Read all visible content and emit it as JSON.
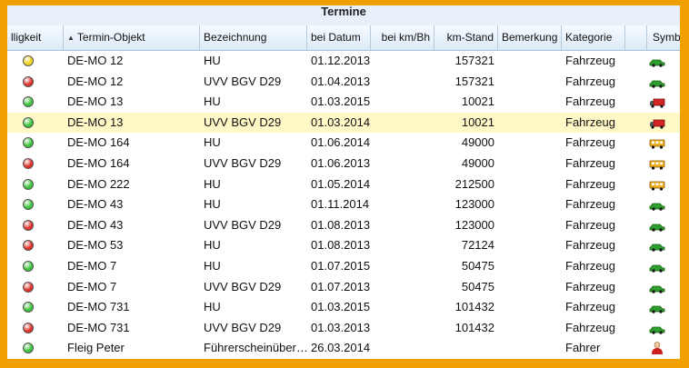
{
  "window": {
    "title": "Termine"
  },
  "columns": [
    {
      "key": "status",
      "label": "lligkeit"
    },
    {
      "key": "object",
      "label": "Termin-Objekt"
    },
    {
      "key": "desc",
      "label": "Bezeichnung"
    },
    {
      "key": "date",
      "label": "bei Datum"
    },
    {
      "key": "kmbh",
      "label": "bei km/Bh"
    },
    {
      "key": "km",
      "label": "km-Stand"
    },
    {
      "key": "note",
      "label": "Bemerkung"
    },
    {
      "key": "cat",
      "label": "Kategorie"
    },
    {
      "key": "blank",
      "label": ""
    },
    {
      "key": "symbol",
      "label": "Symbo"
    }
  ],
  "status_colors": {
    "yellow": "#f2d21c",
    "red": "#e0312a",
    "green": "#3cc33a"
  },
  "rows": [
    {
      "status": "yellow",
      "object": "DE-MO 12",
      "desc": "HU",
      "date": "01.12.2013",
      "kmbh": "",
      "km": "157321",
      "note": "",
      "cat": "Fahrzeug",
      "icon": "car-icon"
    },
    {
      "status": "red",
      "object": "DE-MO 12",
      "desc": "UVV BGV D29",
      "date": "01.04.2013",
      "kmbh": "",
      "km": "157321",
      "note": "",
      "cat": "Fahrzeug",
      "icon": "car-icon"
    },
    {
      "status": "green",
      "object": "DE-MO 13",
      "desc": "HU",
      "date": "01.03.2015",
      "kmbh": "",
      "km": "10021",
      "note": "",
      "cat": "Fahrzeug",
      "icon": "truck-icon"
    },
    {
      "status": "green",
      "object": "DE-MO 13",
      "desc": "UVV BGV D29",
      "date": "01.03.2014",
      "kmbh": "",
      "km": "10021",
      "note": "",
      "cat": "Fahrzeug",
      "icon": "truck-icon",
      "selected": true
    },
    {
      "status": "green",
      "object": "DE-MO 164",
      "desc": "HU",
      "date": "01.06.2014",
      "kmbh": "",
      "km": "49000",
      "note": "",
      "cat": "Fahrzeug",
      "icon": "bus-icon"
    },
    {
      "status": "red",
      "object": "DE-MO 164",
      "desc": "UVV BGV D29",
      "date": "01.06.2013",
      "kmbh": "",
      "km": "49000",
      "note": "",
      "cat": "Fahrzeug",
      "icon": "bus-icon"
    },
    {
      "status": "green",
      "object": "DE-MO 222",
      "desc": "HU",
      "date": "01.05.2014",
      "kmbh": "",
      "km": "212500",
      "note": "",
      "cat": "Fahrzeug",
      "icon": "bus-icon"
    },
    {
      "status": "green",
      "object": "DE-MO 43",
      "desc": "HU",
      "date": "01.11.2014",
      "kmbh": "",
      "km": "123000",
      "note": "",
      "cat": "Fahrzeug",
      "icon": "car-icon"
    },
    {
      "status": "red",
      "object": "DE-MO 43",
      "desc": "UVV BGV D29",
      "date": "01.08.2013",
      "kmbh": "",
      "km": "123000",
      "note": "",
      "cat": "Fahrzeug",
      "icon": "car-icon"
    },
    {
      "status": "red",
      "object": "DE-MO 53",
      "desc": "HU",
      "date": "01.08.2013",
      "kmbh": "",
      "km": "72124",
      "note": "",
      "cat": "Fahrzeug",
      "icon": "car-icon"
    },
    {
      "status": "green",
      "object": "DE-MO 7",
      "desc": "HU",
      "date": "01.07.2015",
      "kmbh": "",
      "km": "50475",
      "note": "",
      "cat": "Fahrzeug",
      "icon": "car-icon"
    },
    {
      "status": "red",
      "object": "DE-MO 7",
      "desc": "UVV BGV D29",
      "date": "01.07.2013",
      "kmbh": "",
      "km": "50475",
      "note": "",
      "cat": "Fahrzeug",
      "icon": "car-icon"
    },
    {
      "status": "green",
      "object": "DE-MO 731",
      "desc": "HU",
      "date": "01.03.2015",
      "kmbh": "",
      "km": "101432",
      "note": "",
      "cat": "Fahrzeug",
      "icon": "car-icon"
    },
    {
      "status": "red",
      "object": "DE-MO 731",
      "desc": "UVV BGV D29",
      "date": "01.03.2013",
      "kmbh": "",
      "km": "101432",
      "note": "",
      "cat": "Fahrzeug",
      "icon": "car-icon"
    },
    {
      "status": "green",
      "object": "Fleig Peter",
      "desc": "Führerscheinüber…",
      "date": "26.03.2014",
      "kmbh": "",
      "km": "",
      "note": "",
      "cat": "Fahrer",
      "icon": "person-icon"
    }
  ]
}
